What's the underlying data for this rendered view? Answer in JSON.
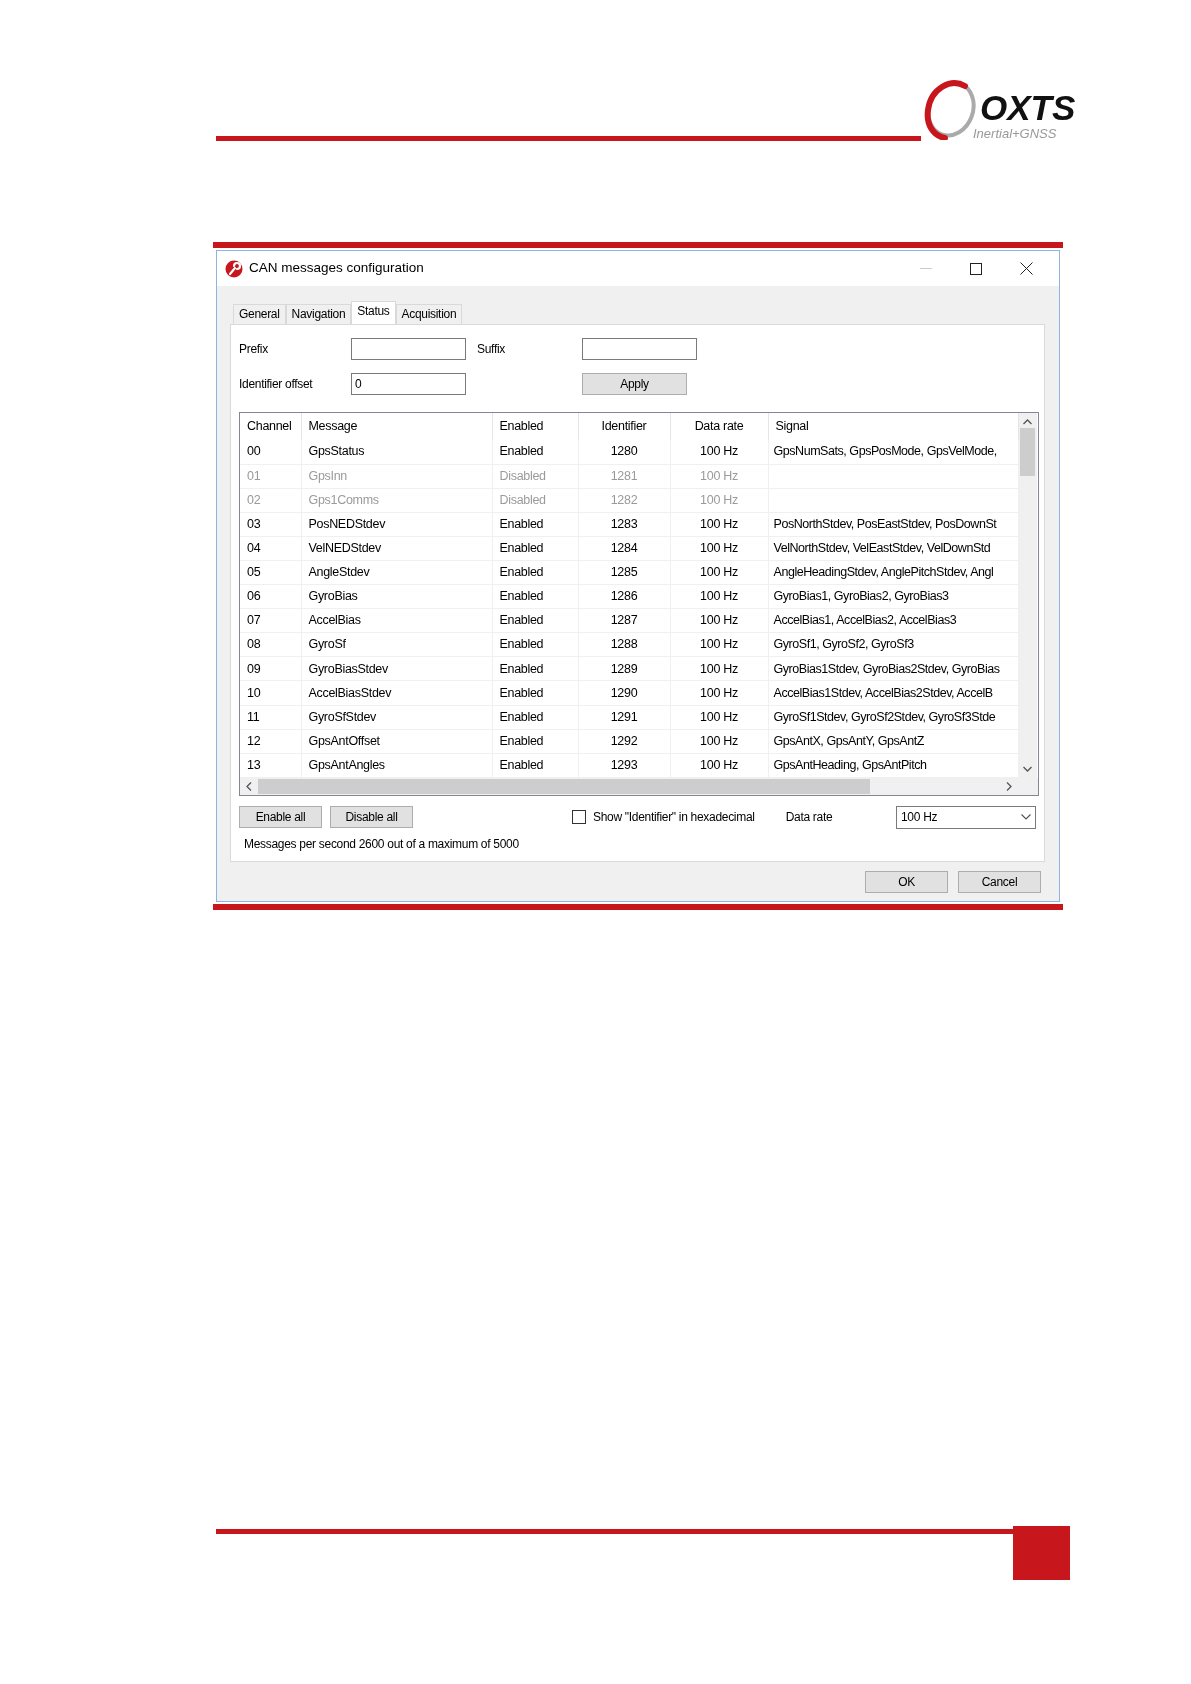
{
  "header": {
    "logo_text": "OXTS",
    "logo_tagline": "Inertial+GNSS"
  },
  "window": {
    "title": "CAN messages configuration"
  },
  "tabs": [
    {
      "label": "General",
      "selected": false
    },
    {
      "label": "Navigation",
      "selected": false
    },
    {
      "label": "Status",
      "selected": true
    },
    {
      "label": "Acquisition",
      "selected": false
    }
  ],
  "form": {
    "prefix": {
      "label": "Prefix"
    },
    "suffix": {
      "label": "Suffix"
    },
    "identifier_offset": {
      "label": "Identifier offset",
      "value": "0"
    },
    "apply_button": "Apply"
  },
  "table": {
    "columns": [
      "Channel",
      "Message",
      "Enabled",
      "Identifier",
      "Data rate",
      "Signal"
    ],
    "rows": [
      {
        "channel": "00",
        "message": "GpsStatus",
        "enabled": "Enabled",
        "identifier": "1280",
        "data_rate": "100 Hz",
        "signal": "GpsNumSats, GpsPosMode, GpsVelMode,",
        "disabled": false
      },
      {
        "channel": "01",
        "message": "GpsInn",
        "enabled": "Disabled",
        "identifier": "1281",
        "data_rate": "100 Hz",
        "disabled": true
      },
      {
        "channel": "02",
        "message": "Gps1Comms",
        "enabled": "Disabled",
        "identifier": "1282",
        "data_rate": "100 Hz",
        "disabled": true
      },
      {
        "channel": "03",
        "message": "PosNEDStdev",
        "enabled": "Enabled",
        "identifier": "1283",
        "data_rate": "100 Hz",
        "signal": "PosNorthStdev, PosEastStdev, PosDownSt",
        "disabled": false
      },
      {
        "channel": "04",
        "message": "VelNEDStdev",
        "enabled": "Enabled",
        "identifier": "1284",
        "data_rate": "100 Hz",
        "signal": "VelNorthStdev, VelEastStdev, VelDownStd",
        "disabled": false
      },
      {
        "channel": "05",
        "message": "AngleStdev",
        "enabled": "Enabled",
        "identifier": "1285",
        "data_rate": "100 Hz",
        "signal": "AngleHeadingStdev, AnglePitchStdev, Angl",
        "disabled": false
      },
      {
        "channel": "06",
        "message": "GyroBias",
        "enabled": "Enabled",
        "identifier": "1286",
        "data_rate": "100 Hz",
        "signal": "GyroBias1, GyroBias2, GyroBias3",
        "disabled": false
      },
      {
        "channel": "07",
        "message": "AccelBias",
        "enabled": "Enabled",
        "identifier": "1287",
        "data_rate": "100 Hz",
        "signal": "AccelBias1, AccelBias2, AccelBias3",
        "disabled": false
      },
      {
        "channel": "08",
        "message": "GyroSf",
        "enabled": "Enabled",
        "identifier": "1288",
        "data_rate": "100 Hz",
        "signal": "GyroSf1, GyroSf2, GyroSf3",
        "disabled": false
      },
      {
        "channel": "09",
        "message": "GyroBiasStdev",
        "enabled": "Enabled",
        "identifier": "1289",
        "data_rate": "100 Hz",
        "signal": "GyroBias1Stdev, GyroBias2Stdev, GyroBias",
        "disabled": false
      },
      {
        "channel": "10",
        "message": "AccelBiasStdev",
        "enabled": "Enabled",
        "identifier": "1290",
        "data_rate": "100 Hz",
        "signal": "AccelBias1Stdev, AccelBias2Stdev, AccelB",
        "disabled": false
      },
      {
        "channel": "11",
        "message": "GyroSfStdev",
        "enabled": "Enabled",
        "identifier": "1291",
        "data_rate": "100 Hz",
        "signal": "GyroSf1Stdev, GyroSf2Stdev, GyroSf3Stde",
        "disabled": false
      },
      {
        "channel": "12",
        "message": "GpsAntOffset",
        "enabled": "Enabled",
        "identifier": "1292",
        "data_rate": "100 Hz",
        "signal": "GpsAntX, GpsAntY, GpsAntZ",
        "disabled": false
      },
      {
        "channel": "13",
        "message": "GpsAntAngles",
        "enabled": "Enabled",
        "identifier": "1293",
        "data_rate": "100 Hz",
        "signal": "GpsAntHeading, GpsAntPitch",
        "disabled": false
      }
    ]
  },
  "buttons": [
    "Enable all",
    "Disable all"
  ],
  "hex_checkbox": {
    "label": "Show \"Identifier\" in hexadecimal",
    "checked": false
  },
  "data_rate": {
    "label": "Data rate",
    "value": "100 Hz"
  },
  "status_text": "Messages per second 2600 out of a maximum of 5000",
  "dialog_buttons": [
    "OK",
    "Cancel"
  ]
}
